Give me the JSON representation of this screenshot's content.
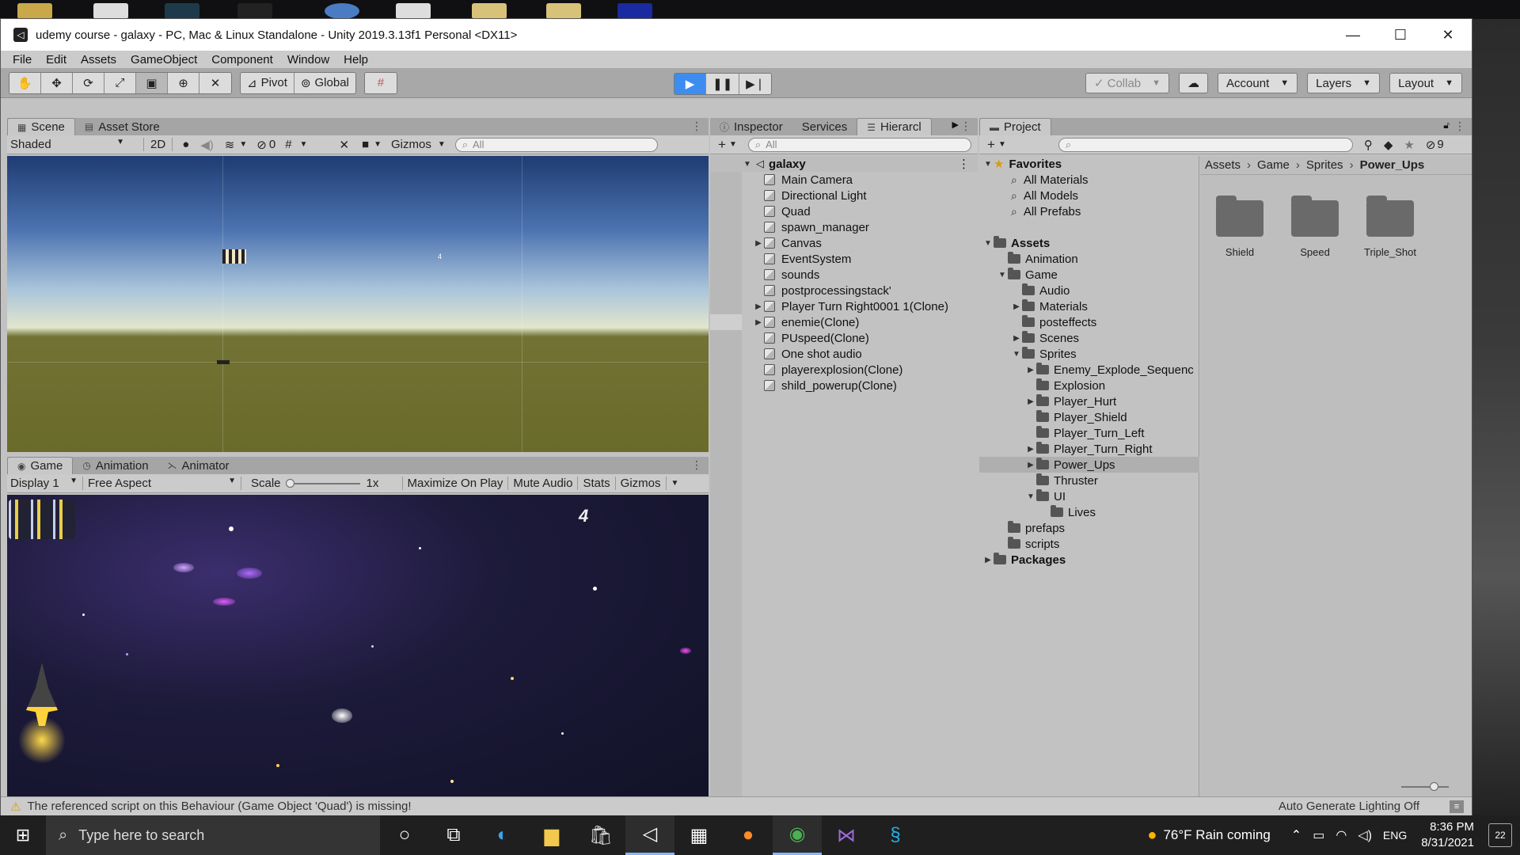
{
  "window": {
    "title": "udemy course - galaxy - PC, Mac & Linux Standalone - Unity 2019.3.13f1 Personal <DX11>",
    "minimize": "—",
    "maximize": "☐",
    "close": "✕"
  },
  "menu": [
    "File",
    "Edit",
    "Assets",
    "GameObject",
    "Component",
    "Window",
    "Help"
  ],
  "toolbar": {
    "pivot": "Pivot",
    "global": "Global",
    "collab": "Collab",
    "account": "Account",
    "layers": "Layers",
    "layout": "Layout"
  },
  "scene": {
    "tab": "Scene",
    "tab2": "Asset Store",
    "shading": "Shaded",
    "mode2d": "2D",
    "hidden_count": "0",
    "gizmos": "Gizmos",
    "search_placeholder": "All"
  },
  "game": {
    "tab": "Game",
    "tab2": "Animation",
    "tab3": "Animator",
    "display": "Display 1",
    "aspect": "Free Aspect",
    "scale_label": "Scale",
    "scale_value": "1x",
    "maximize": "Maximize On Play",
    "mute": "Mute Audio",
    "stats": "Stats",
    "gizmos": "Gizmos",
    "score": "4"
  },
  "hierarchy": {
    "tabs": [
      "Inspector",
      "Services",
      "Hierarcl"
    ],
    "search_placeholder": "All",
    "scene": "galaxy",
    "items": [
      {
        "label": "Main Camera",
        "fold": ""
      },
      {
        "label": "Directional Light",
        "fold": ""
      },
      {
        "label": "Quad",
        "fold": ""
      },
      {
        "label": "spawn_manager",
        "fold": ""
      },
      {
        "label": "Canvas",
        "fold": "▶"
      },
      {
        "label": "EventSystem",
        "fold": ""
      },
      {
        "label": "sounds",
        "fold": ""
      },
      {
        "label": "postprocessingstack'",
        "fold": ""
      },
      {
        "label": "Player Turn Right0001 1(Clone)",
        "fold": "▶"
      },
      {
        "label": "enemie(Clone)",
        "fold": "▶"
      },
      {
        "label": "PUspeed(Clone)",
        "fold": ""
      },
      {
        "label": "One shot audio",
        "fold": ""
      },
      {
        "label": "playerexplosion(Clone)",
        "fold": ""
      },
      {
        "label": "shild_powerup(Clone)",
        "fold": ""
      }
    ]
  },
  "project": {
    "tab": "Project",
    "hidden_count": "9",
    "favorites": {
      "label": "Favorites",
      "items": [
        "All Materials",
        "All Models",
        "All Prefabs"
      ]
    },
    "tree": [
      {
        "label": "Assets",
        "fold": "▼",
        "bold": true
      },
      {
        "label": "Animation",
        "fold": ""
      },
      {
        "label": "Game",
        "fold": "▼"
      },
      {
        "label": "Audio",
        "fold": ""
      },
      {
        "label": "Materials",
        "fold": "▶"
      },
      {
        "label": "posteffects",
        "fold": ""
      },
      {
        "label": "Scenes",
        "fold": "▶"
      },
      {
        "label": "Sprites",
        "fold": "▼"
      },
      {
        "label": "Enemy_Explode_Sequenc",
        "fold": "▶"
      },
      {
        "label": "Explosion",
        "fold": ""
      },
      {
        "label": "Player_Hurt",
        "fold": "▶"
      },
      {
        "label": "Player_Shield",
        "fold": ""
      },
      {
        "label": "Player_Turn_Left",
        "fold": ""
      },
      {
        "label": "Player_Turn_Right",
        "fold": "▶"
      },
      {
        "label": "Power_Ups",
        "fold": "▶"
      },
      {
        "label": "Thruster",
        "fold": ""
      },
      {
        "label": "UI",
        "fold": "▼"
      },
      {
        "label": "Lives",
        "fold": ""
      },
      {
        "label": "prefaps",
        "fold": ""
      },
      {
        "label": "scripts",
        "fold": ""
      },
      {
        "label": "Packages",
        "fold": "▶",
        "bold": true
      }
    ],
    "breadcrumb": [
      "Assets",
      "Game",
      "Sprites",
      "Power_Ups"
    ],
    "folders": [
      "Shield",
      "Speed",
      "Triple_Shot"
    ]
  },
  "status": {
    "message": "The referenced script on this Behaviour (Game Object 'Quad') is missing!",
    "lighting": "Auto Generate Lighting Off"
  },
  "taskbar": {
    "search_placeholder": "Type here to search",
    "weather": "76°F  Rain coming",
    "language": "ENG",
    "time": "8:36 PM",
    "date": "8/31/2021",
    "notifications": "22"
  }
}
